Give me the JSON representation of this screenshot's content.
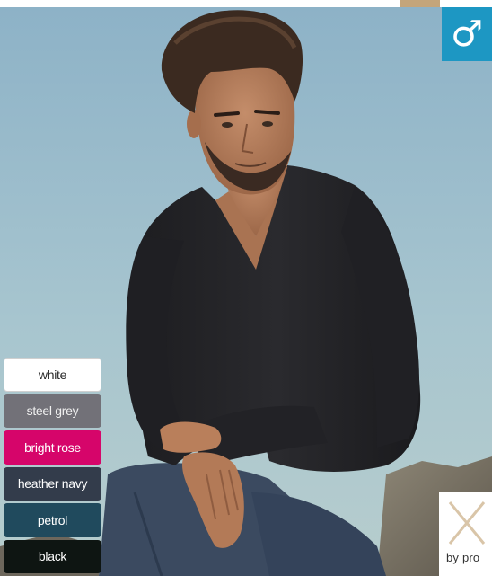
{
  "product": {
    "gender_symbol": "♂",
    "gender_icon": "male-symbol-icon",
    "badge_color": "#1d97c3"
  },
  "colors": {
    "options": [
      {
        "label": "white",
        "hex": "#ffffff"
      },
      {
        "label": "steel grey",
        "hex": "#727178"
      },
      {
        "label": "bright rose",
        "hex": "#d6056a"
      },
      {
        "label": "heather navy",
        "hex": "#333c4b"
      },
      {
        "label": "petrol",
        "hex": "#204a5d"
      },
      {
        "label": "black",
        "hex": "#0e1512"
      }
    ]
  },
  "brand": {
    "tagline": "by pro"
  }
}
